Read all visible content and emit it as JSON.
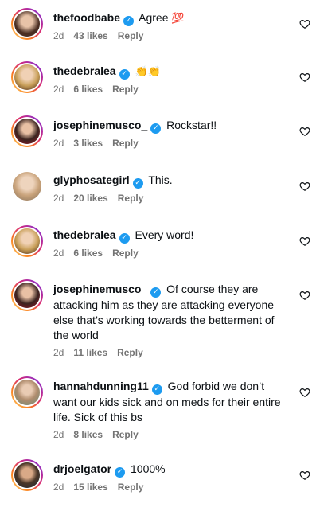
{
  "comments": [
    {
      "user": "thefoodbabe",
      "text": "Agree",
      "emoji": "💯",
      "time": "2d",
      "likes": "43 likes",
      "reply": "Reply",
      "ring": true
    },
    {
      "user": "thedebralea",
      "text": "",
      "emoji": "👏👏",
      "time": "2d",
      "likes": "6 likes",
      "reply": "Reply",
      "ring": true
    },
    {
      "user": "josephinemusco_",
      "text": "Rockstar!!",
      "emoji": "",
      "time": "2d",
      "likes": "3 likes",
      "reply": "Reply",
      "ring": true
    },
    {
      "user": "glyphosategirl",
      "text": "This.",
      "emoji": "",
      "time": "2d",
      "likes": "20 likes",
      "reply": "Reply",
      "ring": false
    },
    {
      "user": "thedebralea",
      "text": "Every word!",
      "emoji": "",
      "time": "2d",
      "likes": "6 likes",
      "reply": "Reply",
      "ring": true
    },
    {
      "user": "josephinemusco_",
      "text": "Of course they are attacking him as they are attacking everyone else that’s working towards the betterment of the world",
      "emoji": "",
      "time": "2d",
      "likes": "11 likes",
      "reply": "Reply",
      "ring": true
    },
    {
      "user": "hannahdunning11",
      "text": "God forbid we don’t want our kids sick and on meds for their entire life. Sick of this bs",
      "emoji": "",
      "time": "2d",
      "likes": "8 likes",
      "reply": "Reply",
      "ring": true
    },
    {
      "user": "drjoelgator",
      "text": "1000%",
      "emoji": "",
      "time": "2d",
      "likes": "15 likes",
      "reply": "Reply",
      "ring": true
    }
  ],
  "colors": {
    "verified": "#1d9bf0",
    "meta": "#737373"
  },
  "icons": {
    "like": "heart-outline-icon",
    "verified": "verified-badge-icon"
  }
}
